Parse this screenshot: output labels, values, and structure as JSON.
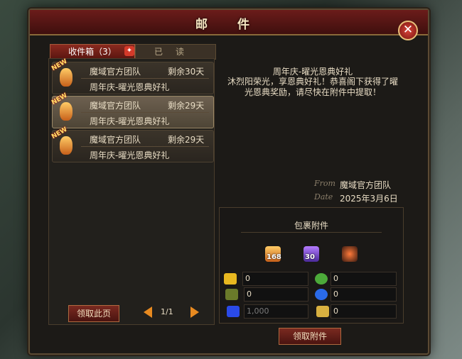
{
  "window": {
    "title": "邮 件",
    "close_label": "✕"
  },
  "tabs": {
    "inbox_label": "收件箱（3）",
    "read_label": "已读"
  },
  "mails": [
    {
      "badge": "NEW",
      "sender": "魔域官方团队",
      "days_left": "剩余30天",
      "subject": "周年庆-曜光恩典好礼"
    },
    {
      "badge": "NEW",
      "sender": "魔域官方团队",
      "days_left": "剩余29天",
      "subject": "周年庆-曜光恩典好礼"
    },
    {
      "badge": "NEW",
      "sender": "魔域官方团队",
      "days_left": "剩余29天",
      "subject": "周年庆-曜光恩典好礼"
    }
  ],
  "pager": {
    "claim_page_label": "领取此页",
    "page_text": "1/1"
  },
  "message": {
    "title": "周年庆-曜光恩典好礼",
    "body": "沐烈阳荣光，享恩典好礼！恭喜阁下获得了曜光恩典奖励，请尽快在附件中提取！",
    "from_label": "From",
    "from_value": "魔域官方团队",
    "date_label": "Date",
    "date_value": "2025年3月6日"
  },
  "attachment": {
    "title": "包裹附件",
    "items": [
      {
        "icon": "orange-crystal-icon",
        "count": "168"
      },
      {
        "icon": "purple-crystal-icon",
        "count": "30"
      },
      {
        "icon": "red-flame-icon",
        "count": ""
      }
    ],
    "resources": [
      {
        "icon": "gold-coins-icon",
        "value": "0"
      },
      {
        "icon": "green-orb-icon",
        "value": "0"
      },
      {
        "icon": "wood-box-icon",
        "value": "0"
      },
      {
        "icon": "blue-swirl-icon",
        "value": "0"
      },
      {
        "icon": "blue-gem-icon",
        "value": "1,000"
      },
      {
        "icon": "gold-card-icon",
        "value": "0"
      }
    ],
    "claim_label": "领取附件"
  },
  "colors": {
    "accent_red": "#7a2a20",
    "gold": "#e88a20"
  }
}
